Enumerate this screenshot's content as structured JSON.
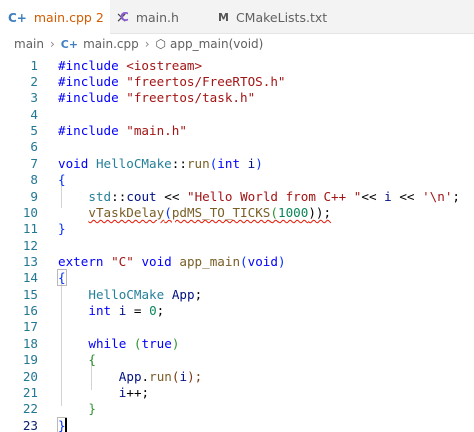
{
  "tabs": [
    {
      "icon": "C+",
      "label": "main.cpp",
      "badge": "2",
      "close": "×"
    },
    {
      "icon": "C",
      "label": "main.h"
    },
    {
      "icon": "M",
      "label": "CMakeLists.txt"
    }
  ],
  "breadcrumb": {
    "folder": "main",
    "sep": "›",
    "file_icon": "C+",
    "file": "main.cpp",
    "symbol_icon": "⬡",
    "symbol": "app_main(void)"
  },
  "editor": {
    "language": "cpp",
    "current_line": 23,
    "lines": [
      {
        "n": "1",
        "t": [
          "#include",
          " ",
          "<iostream>"
        ]
      },
      {
        "n": "2",
        "t": [
          "#include",
          " ",
          "\"freertos/FreeRTOS.h\""
        ]
      },
      {
        "n": "3",
        "t": [
          "#include",
          " ",
          "\"freertos/task.h\""
        ]
      },
      {
        "n": "4",
        "t": []
      },
      {
        "n": "5",
        "t": [
          "#include",
          " ",
          "\"main.h\""
        ]
      },
      {
        "n": "6",
        "t": []
      },
      {
        "n": "7",
        "t": [
          "void",
          " ",
          "HelloCMake",
          "::",
          "run",
          "(",
          "int",
          " ",
          "i",
          ")"
        ]
      },
      {
        "n": "8",
        "t": [
          "{"
        ]
      },
      {
        "n": "9",
        "t": [
          "std",
          "::",
          "cout",
          " << ",
          "\"Hello World from C++ \"",
          "<< ",
          "i",
          " << ",
          "'\\n'",
          ";"
        ]
      },
      {
        "n": "10",
        "t": [
          "vTaskDelay",
          "(",
          "pdMS_TO_TICKS",
          "(",
          "1000",
          "));"
        ]
      },
      {
        "n": "11",
        "t": [
          "}"
        ]
      },
      {
        "n": "12",
        "t": []
      },
      {
        "n": "13",
        "t": [
          "extern",
          " ",
          "\"C\"",
          " ",
          "void",
          " ",
          "app_main",
          "(",
          "void",
          ")"
        ]
      },
      {
        "n": "14",
        "t": [
          "{"
        ]
      },
      {
        "n": "15",
        "t": [
          "HelloCMake",
          " ",
          "App",
          ";"
        ]
      },
      {
        "n": "16",
        "t": [
          "int",
          " ",
          "i",
          " = ",
          "0",
          ";"
        ]
      },
      {
        "n": "17",
        "t": []
      },
      {
        "n": "18",
        "t": [
          "while",
          " (",
          "true",
          ")"
        ]
      },
      {
        "n": "19",
        "t": [
          "{"
        ]
      },
      {
        "n": "20",
        "t": [
          "App",
          ".",
          "run",
          "(",
          "i",
          ");"
        ]
      },
      {
        "n": "21",
        "t": [
          "i",
          "++;"
        ]
      },
      {
        "n": "22",
        "t": [
          "}"
        ]
      },
      {
        "n": "23",
        "t": [
          "}"
        ]
      }
    ]
  }
}
